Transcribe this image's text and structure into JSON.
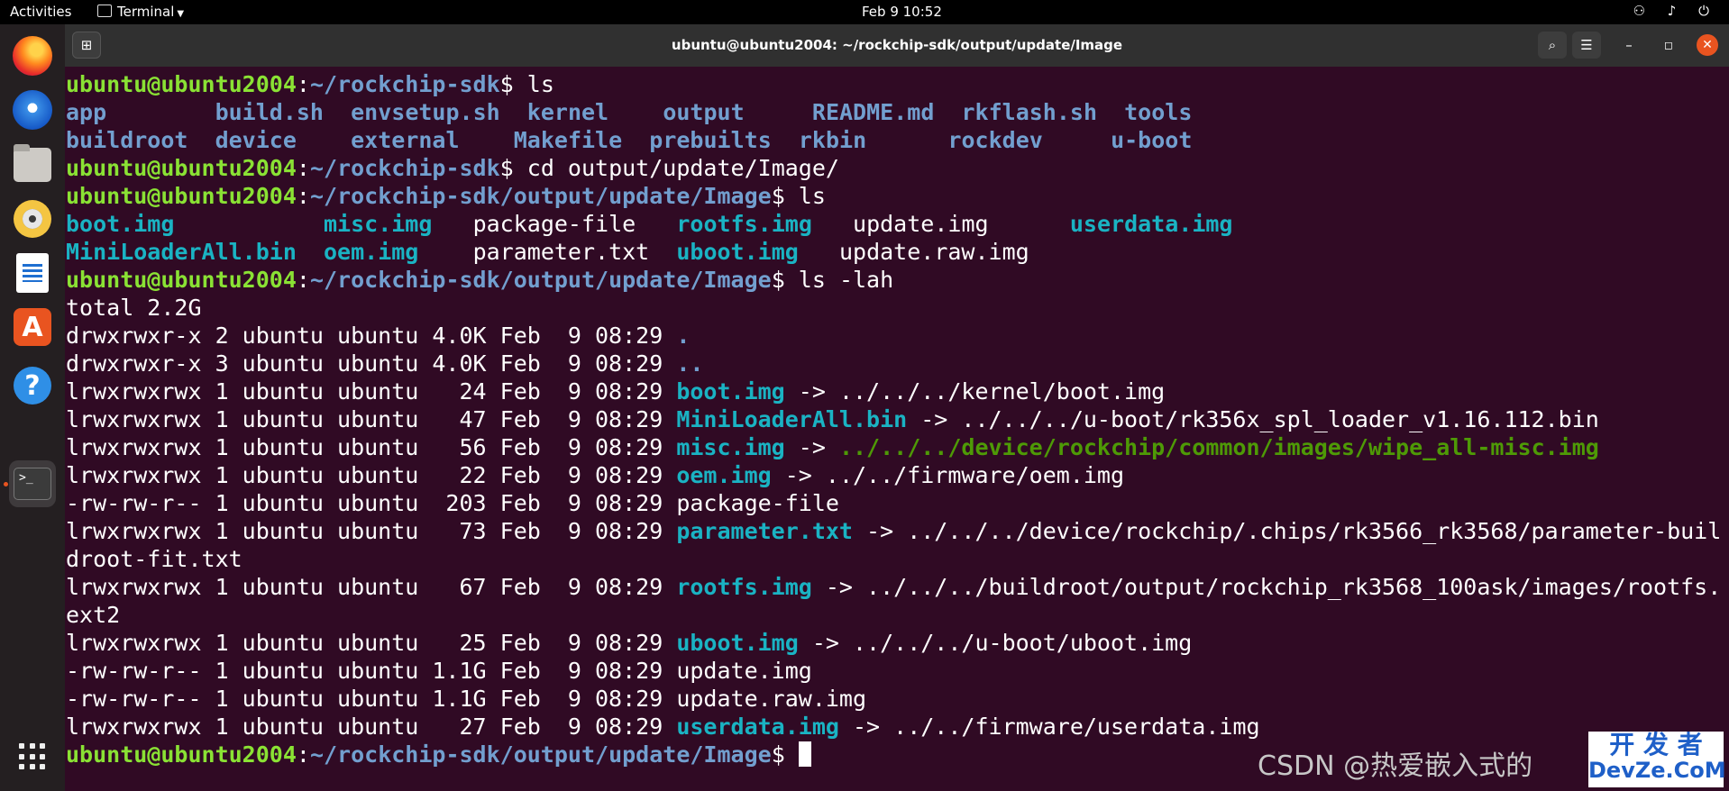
{
  "topbar": {
    "activities": "Activities",
    "app_menu": "Terminal",
    "clock": "Feb 9  10:52",
    "tray_icons": [
      "network-icon",
      "volume-icon",
      "power-icon"
    ],
    "tray": "⚇ ♪ ⏻"
  },
  "dock": {
    "items": [
      "firefox",
      "thunderbird",
      "files",
      "rhythmbox",
      "libreoffice-writer",
      "ubuntu-software",
      "help",
      "terminal",
      "show-applications"
    ],
    "store_glyph": "A",
    "help_glyph": "?",
    "term_glyph": ">_"
  },
  "window": {
    "title": "ubuntu@ubuntu2004: ~/rockchip-sdk/output/update/Image",
    "buttons": {
      "new_tab": "⊞",
      "search": "⌕",
      "menu": "☰",
      "minimize": "–",
      "maximize": "◻",
      "close": "✕"
    }
  },
  "terminal": {
    "user": "ubuntu@ubuntu2004",
    "path_sdk": "~/rockchip-sdk",
    "path_image": "~/rockchip-sdk/output/update/Image",
    "cmd1": " ls",
    "ls1_row1": [
      "app",
      "build.sh",
      "envsetup.sh",
      "kernel",
      "output",
      "README.md",
      "rkflash.sh",
      "tools"
    ],
    "ls1_row2": [
      "buildroot",
      "device",
      "external",
      "Makefile",
      "prebuilts",
      "rkbin",
      "rockdev",
      "u-boot"
    ],
    "cmd2": " cd output/update/Image/",
    "cmd3": " ls",
    "ls2_row1": [
      "boot.img",
      "misc.img",
      "package-file",
      "rootfs.img",
      "update.img",
      "userdata.img"
    ],
    "ls2_row2": [
      "MiniLoaderAll.bin",
      "oem.img",
      "parameter.txt",
      "uboot.img",
      "update.raw.img"
    ],
    "cmd4": " ls -lah",
    "total": "total 2.2G",
    "entries": [
      {
        "meta": "drwxrwxr-x 2 ubuntu ubuntu 4.0K Feb  9 08:29 ",
        "name": ".",
        "arrow": "",
        "target": ""
      },
      {
        "meta": "drwxrwxr-x 3 ubuntu ubuntu 4.0K Feb  9 08:29 ",
        "name": "..",
        "arrow": "",
        "target": ""
      },
      {
        "meta": "lrwxrwxrwx 1 ubuntu ubuntu   24 Feb  9 08:29 ",
        "name": "boot.img",
        "arrow": " -> ",
        "target": "../../../kernel/boot.img"
      },
      {
        "meta": "lrwxrwxrwx 1 ubuntu ubuntu   47 Feb  9 08:29 ",
        "name": "MiniLoaderAll.bin",
        "arrow": " -> ",
        "target": "../../../u-boot/rk356x_spl_loader_v1.16.112.bin"
      },
      {
        "meta": "lrwxrwxrwx 1 ubuntu ubuntu   56 Feb  9 08:29 ",
        "name": "misc.img",
        "arrow": " -> ",
        "target": "../../../device/rockchip/common/images/wipe_all-misc.img"
      },
      {
        "meta": "lrwxrwxrwx 1 ubuntu ubuntu   22 Feb  9 08:29 ",
        "name": "oem.img",
        "arrow": " -> ",
        "target": "../../firmware/oem.img"
      },
      {
        "meta": "-rw-rw-r-- 1 ubuntu ubuntu  203 Feb  9 08:29 ",
        "name": "package-file",
        "arrow": "",
        "target": ""
      },
      {
        "meta": "lrwxrwxrwx 1 ubuntu ubuntu   73 Feb  9 08:29 ",
        "name": "parameter.txt",
        "arrow": " -> ",
        "target": "../../../device/rockchip/.chips/rk3566_rk3568/parameter-buil",
        "cont": "droot-fit.txt"
      },
      {
        "meta": "lrwxrwxrwx 1 ubuntu ubuntu   67 Feb  9 08:29 ",
        "name": "rootfs.img",
        "arrow": " -> ",
        "target": "../../../buildroot/output/rockchip_rk3568_100ask/images/rootfs.",
        "cont": "ext2"
      },
      {
        "meta": "lrwxrwxrwx 1 ubuntu ubuntu   25 Feb  9 08:29 ",
        "name": "uboot.img",
        "arrow": " -> ",
        "target": "../../../u-boot/uboot.img"
      },
      {
        "meta": "-rw-rw-r-- 1 ubuntu ubuntu 1.1G Feb  9 08:29 ",
        "name": "update.img",
        "arrow": "",
        "target": ""
      },
      {
        "meta": "-rw-rw-r-- 1 ubuntu ubuntu 1.1G Feb  9 08:29 ",
        "name": "update.raw.img",
        "arrow": "",
        "target": ""
      },
      {
        "meta": "lrwxrwxrwx 1 ubuntu ubuntu   27 Feb  9 08:29 ",
        "name": "userdata.img",
        "arrow": " -> ",
        "target": "../../firmware/userdata.img"
      }
    ]
  },
  "watermark": {
    "text": "CSDN @热爱嵌入式的",
    "badge_top": "开 发 者",
    "badge_bottom": "DevZe.CoM"
  },
  "colors": {
    "terminal_bg": "#300a24",
    "prompt_user": "#8ae234",
    "prompt_path": "#729fcf",
    "symlink": "#1ab3c3",
    "bad_link_target": "#4e9a06"
  }
}
